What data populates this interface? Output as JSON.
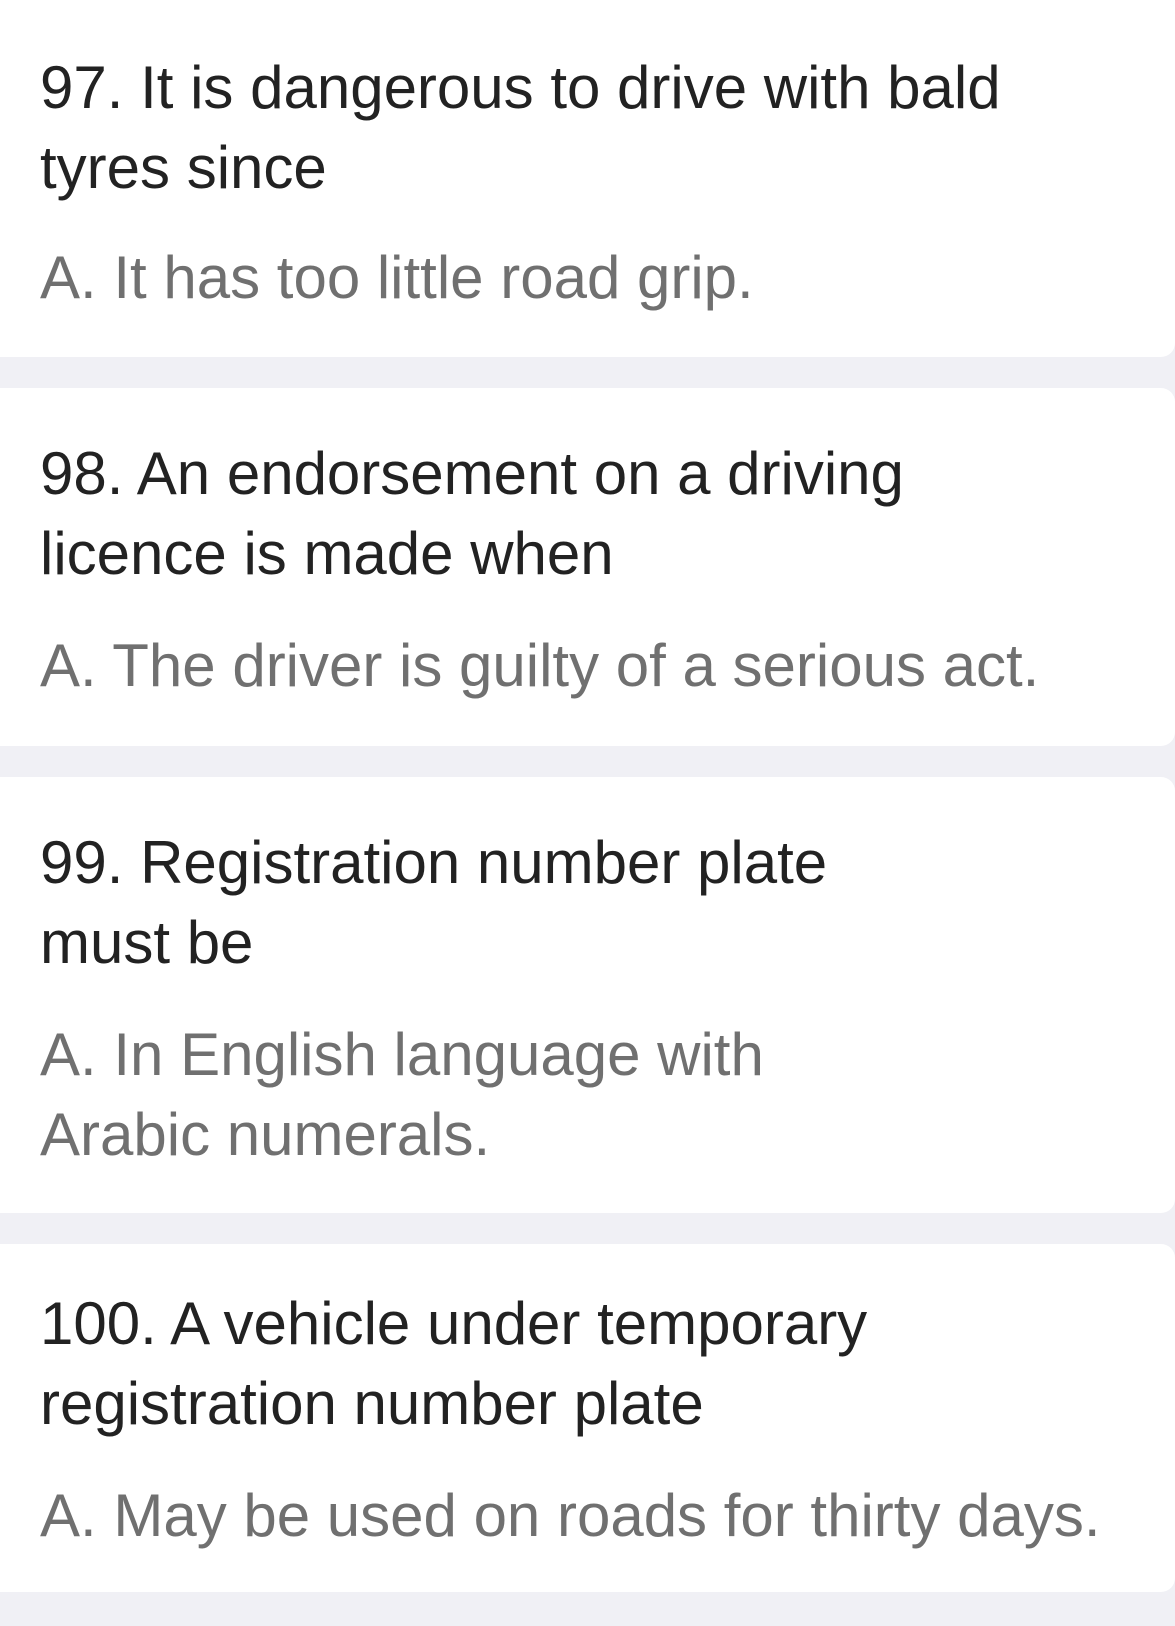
{
  "questions": [
    {
      "question": "97. It is dangerous to drive with bald tyres since",
      "answer": "A. It has too little road grip."
    },
    {
      "question": "98. An endorsement on a driving licence is made when",
      "answer": "A. The driver is guilty of a serious act."
    },
    {
      "question": "99. Registration number plate must be",
      "answer": "A. In English language with Arabic numerals."
    },
    {
      "question": "100. A vehicle under temporary registration number plate",
      "answer": "A. May be used on roads for thirty days."
    }
  ]
}
